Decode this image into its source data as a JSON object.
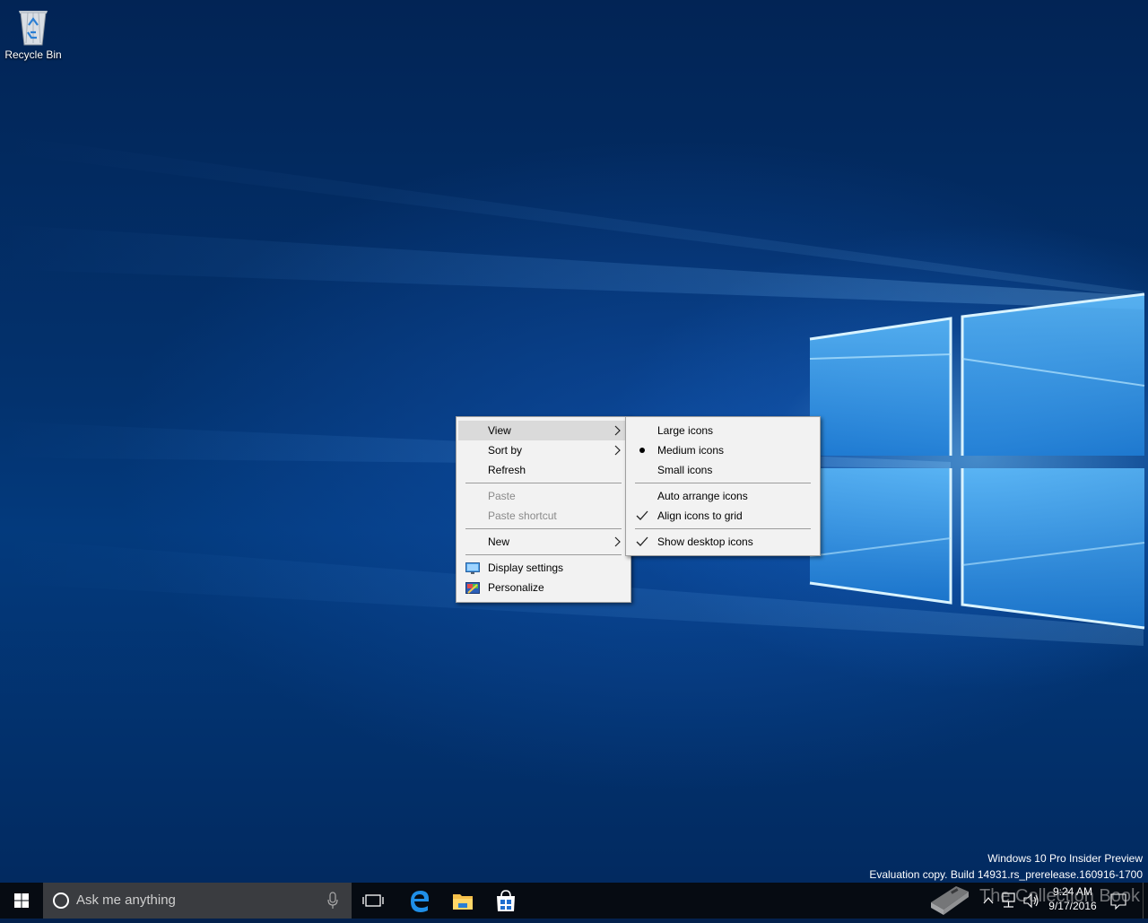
{
  "desktop": {
    "icons": [
      {
        "label": "Recycle Bin",
        "icon": "recycle-bin-icon"
      }
    ]
  },
  "context_menu": {
    "items": [
      {
        "label": "View",
        "has_submenu": true,
        "highlighted": true,
        "enabled": true
      },
      {
        "label": "Sort by",
        "has_submenu": true,
        "enabled": true
      },
      {
        "label": "Refresh",
        "enabled": true
      },
      {
        "label": "Paste",
        "enabled": false
      },
      {
        "label": "Paste shortcut",
        "enabled": false
      },
      {
        "label": "New",
        "has_submenu": true,
        "enabled": true
      },
      {
        "label": "Display settings",
        "icon": "display-icon",
        "enabled": true
      },
      {
        "label": "Personalize",
        "icon": "personalize-icon",
        "enabled": true
      }
    ]
  },
  "view_submenu": {
    "items": [
      {
        "label": "Large icons",
        "selected": false
      },
      {
        "label": "Medium icons",
        "selected": true,
        "indicator": "bullet"
      },
      {
        "label": "Small icons",
        "selected": false
      },
      {
        "label": "Auto arrange icons",
        "checked": false
      },
      {
        "label": "Align icons to grid",
        "checked": true
      },
      {
        "label": "Show desktop icons",
        "checked": true
      }
    ]
  },
  "watermark": {
    "line1": "Windows 10 Pro Insider Preview",
    "line2": "Evaluation copy. Build 14931.rs_prerelease.160916-1700"
  },
  "taskbar": {
    "start_icon": "windows-logo-icon",
    "search_placeholder": "Ask me anything",
    "pinned": [
      "task-view-icon",
      "edge-icon",
      "file-explorer-icon",
      "store-icon"
    ],
    "tray_icons": [
      "show-hidden-icons-chevron-icon",
      "network-icon",
      "volume-icon",
      "action-center-icon"
    ],
    "time": "9:24 AM",
    "date": "9/17/2016"
  },
  "overlay": {
    "text": "The Collection Book",
    "icon": "book-icon"
  }
}
